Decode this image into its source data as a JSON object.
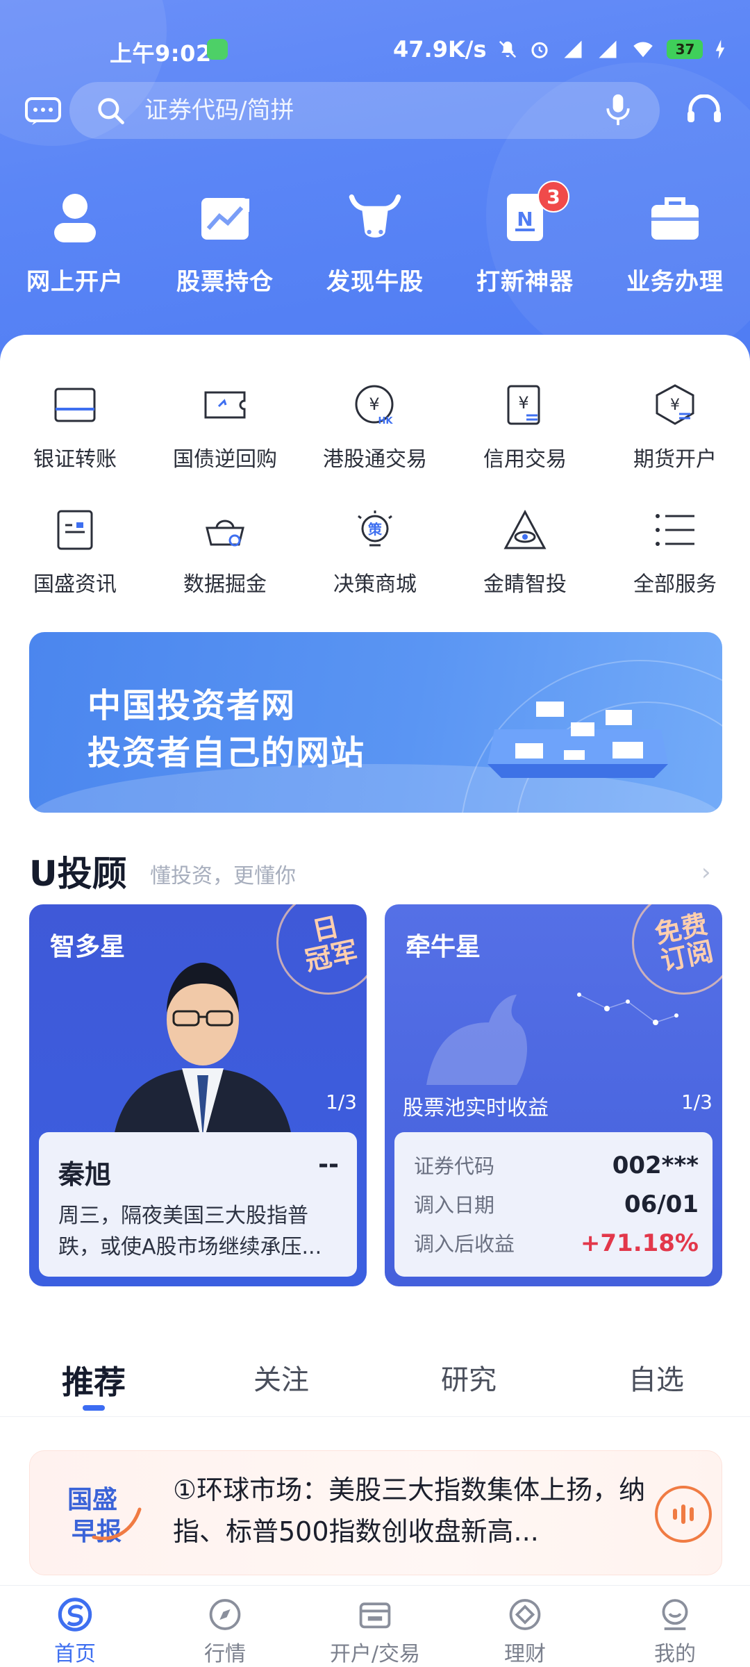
{
  "status_bar": {
    "time": "上午9:02",
    "network_speed": "47.9K/s",
    "battery": "37"
  },
  "search": {
    "placeholder": "证券代码/简拼"
  },
  "top_actions": [
    {
      "label": "网上开户",
      "icon": "user-icon"
    },
    {
      "label": "股票持仓",
      "icon": "chart-up-icon"
    },
    {
      "label": "发现牛股",
      "icon": "bull-icon"
    },
    {
      "label": "打新神器",
      "icon": "new-stock-icon",
      "badge": "3"
    },
    {
      "label": "业务办理",
      "icon": "briefcase-icon"
    }
  ],
  "services": [
    {
      "label": "银证转账",
      "icon": "card-icon"
    },
    {
      "label": "国债逆回购",
      "icon": "ticket-icon"
    },
    {
      "label": "港股通交易",
      "icon": "yen-hk-icon"
    },
    {
      "label": "信用交易",
      "icon": "credit-icon"
    },
    {
      "label": "期货开户",
      "icon": "futures-icon"
    },
    {
      "label": "国盛资讯",
      "icon": "news-icon"
    },
    {
      "label": "数据掘金",
      "icon": "gold-icon"
    },
    {
      "label": "决策商城",
      "icon": "strategy-icon"
    },
    {
      "label": "金睛智投",
      "icon": "eye-icon"
    },
    {
      "label": "全部服务",
      "icon": "list-icon"
    }
  ],
  "banner": {
    "line1": "中国投资者网",
    "line2": "投资者自己的网站"
  },
  "advisor": {
    "title": "U投顾",
    "subtitle": "懂投资，更懂你",
    "card_left": {
      "title": "智多星",
      "stamp": "日冠军",
      "stamp_line1": "日",
      "stamp_line2": "冠军",
      "pager": "1/3",
      "name": "秦旭",
      "value": "--",
      "desc": "周三，隔夜美国三大股指普跌，或使A股市场继续承压..."
    },
    "card_right": {
      "title": "牵牛星",
      "stamp_line1": "免费",
      "stamp_line2": "订阅",
      "caption": "股票池实时收益",
      "pager": "1/3",
      "rows": [
        {
          "key": "证券代码",
          "value": "002***"
        },
        {
          "key": "调入日期",
          "value": "06/01"
        },
        {
          "key": "调入后收益",
          "value": "+71.18%"
        }
      ]
    }
  },
  "feed_tabs": [
    "推荐",
    "关注",
    "研究",
    "自选"
  ],
  "news": {
    "logo_line1": "国盛",
    "logo_line2": "早报",
    "text": "①环球市场：美股三大指数集体上扬，纳指、标普500指数创收盘新高..."
  },
  "bottom_nav": [
    {
      "label": "首页",
      "icon": "home-logo-icon",
      "active": true
    },
    {
      "label": "行情",
      "icon": "compass-icon"
    },
    {
      "label": "开户/交易",
      "icon": "wallet-icon"
    },
    {
      "label": "理财",
      "icon": "diamond-icon"
    },
    {
      "label": "我的",
      "icon": "profile-icon"
    }
  ],
  "colors": {
    "header": "#5b86f6",
    "accent": "#3e6ff0",
    "gain": "#e2374a",
    "badge": "#f04a4a"
  }
}
